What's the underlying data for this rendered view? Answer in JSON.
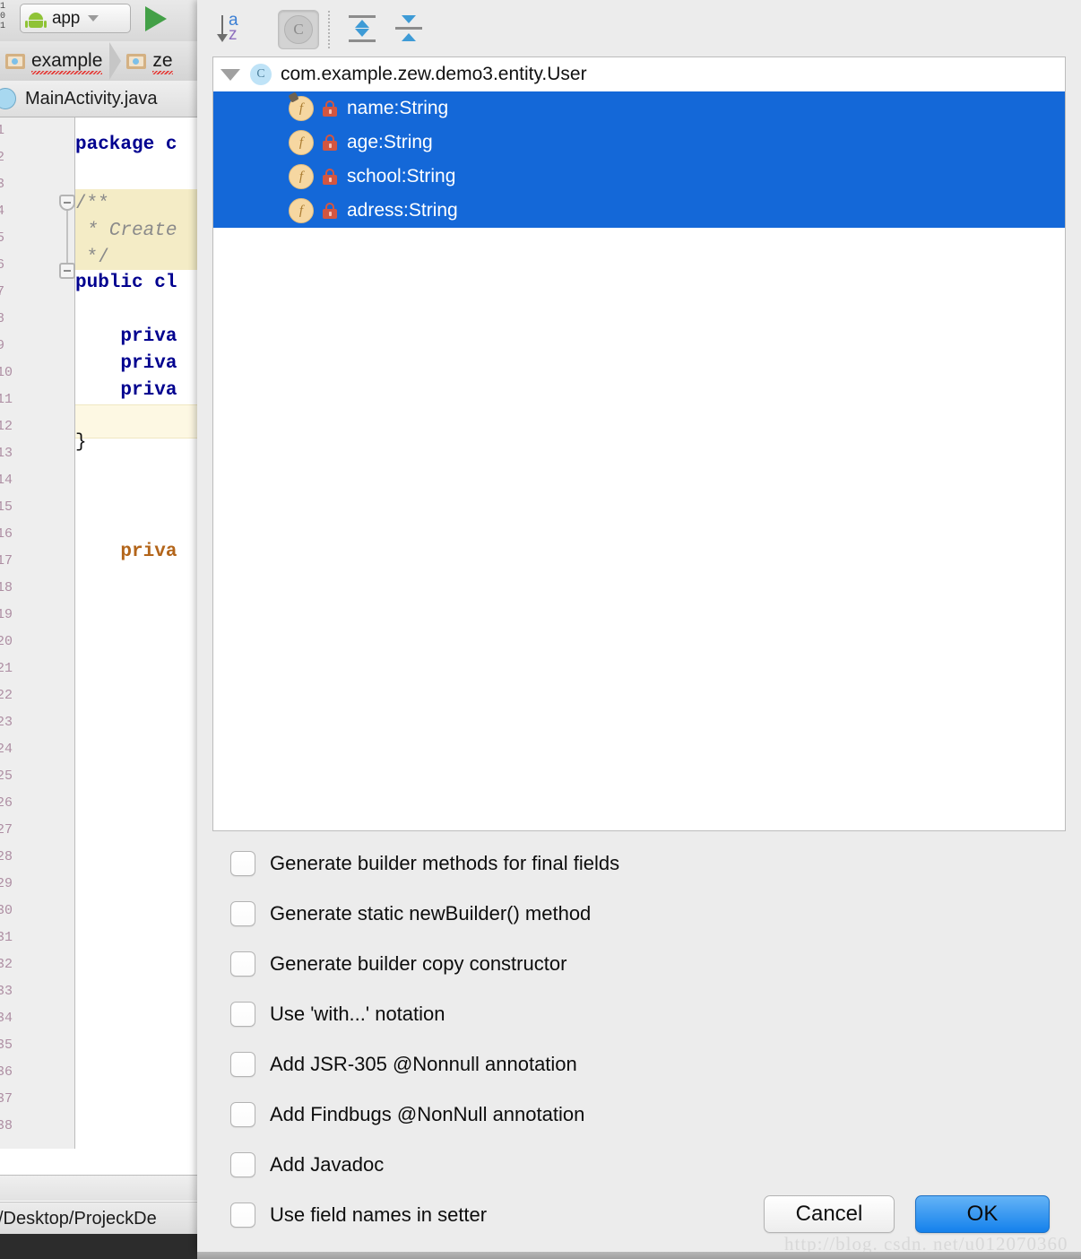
{
  "ide": {
    "toolbar": {
      "digits": "101\n1",
      "run_config_label": "app",
      "android_icon": "android-icon",
      "dropdown_icon": "chevron-down-icon",
      "run_icon": "run-triangle-icon"
    },
    "breadcrumb": {
      "items": [
        {
          "label": "example",
          "icon": "folder-icon"
        },
        {
          "label": "ze",
          "icon": "folder-icon"
        }
      ]
    },
    "tab": {
      "label": "MainActivity.java",
      "icon": "java-file-icon"
    },
    "code_lines": [
      {
        "text": "package c",
        "kind": "keyword-line"
      },
      {
        "text": "",
        "kind": "blank"
      },
      {
        "text": "/**",
        "kind": "comment"
      },
      {
        "text": " * Create",
        "kind": "comment-italic"
      },
      {
        "text": " */",
        "kind": "comment"
      },
      {
        "text": "public cl",
        "kind": "keyword-line"
      },
      {
        "text": "    priva",
        "kind": "warn-field"
      },
      {
        "text": "    priva",
        "kind": "keyword-line"
      },
      {
        "text": "    priva",
        "kind": "keyword-line"
      },
      {
        "text": "    priva",
        "kind": "keyword-line"
      },
      {
        "text": "",
        "kind": "caret-line"
      },
      {
        "text": "}",
        "kind": "plain"
      }
    ],
    "status_path": "/Desktop/ProjeckDe"
  },
  "dialog": {
    "toolbar_buttons": [
      {
        "name": "sort-alphabetically-button",
        "icon": "sort-az-icon",
        "pressed": false
      },
      {
        "name": "group-by-class-button",
        "icon": "class-circle-icon",
        "label": "C",
        "pressed": true
      },
      {
        "name": "expand-all-button",
        "icon": "expand-all-icon",
        "pressed": false
      },
      {
        "name": "collapse-all-button",
        "icon": "collapse-all-icon",
        "pressed": false
      }
    ],
    "tree": {
      "root": {
        "label": "com.example.zew.demo3.entity.User",
        "icon": "class-circle-icon",
        "badge": "C",
        "expanded": true,
        "toggle_icon": "triangle-down-icon"
      },
      "fields": [
        {
          "label": "name:String",
          "icon": "field-icon",
          "badge": "f",
          "lock_icon": "lock-icon",
          "selected": true
        },
        {
          "label": "age:String",
          "icon": "field-icon",
          "badge": "f",
          "lock_icon": "lock-icon",
          "selected": true
        },
        {
          "label": "school:String",
          "icon": "field-icon",
          "badge": "f",
          "lock_icon": "lock-icon",
          "selected": true
        },
        {
          "label": "adress:String",
          "icon": "field-icon",
          "badge": "f",
          "lock_icon": "lock-icon",
          "selected": true
        }
      ]
    },
    "options": [
      {
        "label": "Generate builder methods for final fields",
        "checked": false
      },
      {
        "label": "Generate static newBuilder() method",
        "checked": false
      },
      {
        "label": "Generate builder copy constructor",
        "checked": false
      },
      {
        "label": "Use 'with...' notation",
        "checked": false
      },
      {
        "label": "Add JSR-305 @Nonnull annotation",
        "checked": false
      },
      {
        "label": "Add Findbugs @NonNull annotation",
        "checked": false
      },
      {
        "label": "Add Javadoc",
        "checked": false
      },
      {
        "label": "Use field names in setter",
        "checked": false
      }
    ],
    "buttons": {
      "cancel": "Cancel",
      "ok": "OK"
    }
  },
  "watermark": "http://blog. csdn. net/u012070360",
  "colors": {
    "selection_blue": "#1468d8",
    "dialog_bg": "#ececec",
    "ok_button_blue": "#1481ec",
    "field_icon_amber": "#f6d7a1",
    "lock_red": "#d35640",
    "keyword_blue": "#00008f",
    "comment_highlight": "#f4ecc6"
  }
}
